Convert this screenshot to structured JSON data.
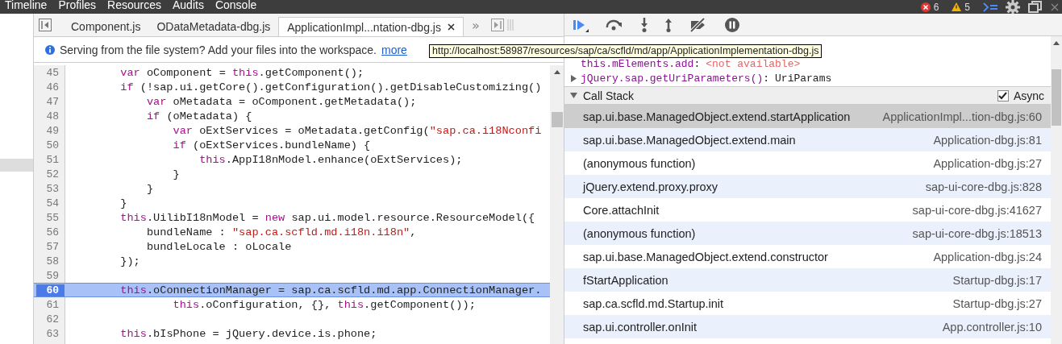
{
  "menu_bar": {
    "items": [
      "Timeline",
      "Profiles",
      "Resources",
      "Audits",
      "Console"
    ],
    "errors": "6",
    "warnings": "5"
  },
  "editor": {
    "tabs": [
      {
        "label": "Component.js",
        "selected": false,
        "closable": false
      },
      {
        "label": "ODataMetadata-dbg.js",
        "selected": false,
        "closable": false
      },
      {
        "label": "ApplicationImpl...ntation-dbg.js",
        "selected": true,
        "closable": true
      }
    ],
    "more_tabs": "»",
    "infobar": {
      "message": "Serving from the file system? Add your files into the workspace.",
      "link": "more"
    },
    "tooltip": "http://localhost:58987/resources/sap/ca/scfld/md/app/ApplicationImplementation-dbg.js",
    "lines": [
      {
        "number": "45",
        "selected": false,
        "segments": [
          {
            "kind": "keyword",
            "text": "        var"
          },
          {
            "kind": "plain",
            "text": " oComponent = "
          },
          {
            "kind": "keyword",
            "text": "this"
          },
          {
            "kind": "plain",
            "text": ".getComponent();"
          }
        ]
      },
      {
        "number": "46",
        "selected": false,
        "segments": [
          {
            "kind": "keyword",
            "text": "        if"
          },
          {
            "kind": "plain",
            "text": " (!sap.ui.getCore().getConfiguration().getDisableCustomizing()"
          }
        ]
      },
      {
        "number": "47",
        "selected": false,
        "segments": [
          {
            "kind": "keyword",
            "text": "            var"
          },
          {
            "kind": "plain",
            "text": " oMetadata = oComponent.getMetadata();"
          }
        ]
      },
      {
        "number": "48",
        "selected": false,
        "segments": [
          {
            "kind": "keyword",
            "text": "            if"
          },
          {
            "kind": "plain",
            "text": " (oMetadata) {"
          }
        ]
      },
      {
        "number": "49",
        "selected": false,
        "segments": [
          {
            "kind": "keyword",
            "text": "                var"
          },
          {
            "kind": "plain",
            "text": " oExtServices = oMetadata.getConfig("
          },
          {
            "kind": "string",
            "text": "\"sap.ca.i18Nconfi"
          }
        ]
      },
      {
        "number": "50",
        "selected": false,
        "segments": [
          {
            "kind": "keyword",
            "text": "                if"
          },
          {
            "kind": "plain",
            "text": " (oExtServices.bundleName) {"
          }
        ]
      },
      {
        "number": "51",
        "selected": false,
        "segments": [
          {
            "kind": "keyword",
            "text": "                    this"
          },
          {
            "kind": "plain",
            "text": ".AppI18nModel.enhance(oExtServices);"
          }
        ]
      },
      {
        "number": "52",
        "selected": false,
        "segments": [
          {
            "kind": "plain",
            "text": "                }"
          }
        ]
      },
      {
        "number": "53",
        "selected": false,
        "segments": [
          {
            "kind": "plain",
            "text": "            }"
          }
        ]
      },
      {
        "number": "54",
        "selected": false,
        "segments": [
          {
            "kind": "plain",
            "text": "        }"
          }
        ]
      },
      {
        "number": "55",
        "selected": false,
        "segments": [
          {
            "kind": "keyword",
            "text": "        this"
          },
          {
            "kind": "plain",
            "text": ".UilibI18nModel = "
          },
          {
            "kind": "keyword",
            "text": "new"
          },
          {
            "kind": "plain",
            "text": " sap.ui.model.resource.ResourceModel({"
          }
        ]
      },
      {
        "number": "56",
        "selected": false,
        "segments": [
          {
            "kind": "plain",
            "text": "            bundleName : "
          },
          {
            "kind": "string",
            "text": "\"sap.ca.scfld.md.i18n.i18n\""
          },
          {
            "kind": "plain",
            "text": ","
          }
        ]
      },
      {
        "number": "57",
        "selected": false,
        "segments": [
          {
            "kind": "plain",
            "text": "            bundleLocale : oLocale"
          }
        ]
      },
      {
        "number": "58",
        "selected": false,
        "segments": [
          {
            "kind": "plain",
            "text": "        });"
          }
        ]
      },
      {
        "number": "59",
        "selected": false
      },
      {
        "number": "60",
        "selected": true,
        "segments": [
          {
            "kind": "keyword",
            "text": "        this"
          },
          {
            "kind": "plain",
            "text": ".oConnectionManager = sap.ca.scfld.md.app.ConnectionManager."
          }
        ]
      },
      {
        "number": "61",
        "selected": false,
        "segments": [
          {
            "kind": "keyword",
            "text": "                this"
          },
          {
            "kind": "plain",
            "text": ".oConfiguration, {}, "
          },
          {
            "kind": "keyword",
            "text": "this"
          },
          {
            "kind": "plain",
            "text": ".getComponent());"
          }
        ]
      },
      {
        "number": "62",
        "selected": false
      },
      {
        "number": "63",
        "selected": false,
        "segments": [
          {
            "kind": "keyword",
            "text": "        this"
          },
          {
            "kind": "plain",
            "text": ".bIsPhone = jQuery.device.is.phone;"
          }
        ]
      }
    ]
  },
  "debugger": {
    "watch": [
      {
        "name": "this.mElements.add",
        "separator": ":",
        "value": "<not available>",
        "kind": "unavailable",
        "expandable": false
      },
      {
        "name": "jQuery.sap.getUriParameters()",
        "separator": ":",
        "value": "UriParams",
        "kind": "object",
        "expandable": true
      }
    ],
    "call_stack": {
      "title": "Call Stack",
      "expanded": true,
      "async_label": "Async",
      "async_checked": true,
      "frames": [
        {
          "function": "sap.ui.base.ManagedObject.extend.startApplication",
          "location": "ApplicationImpl...tion-dbg.js:60",
          "selected": true
        },
        {
          "function": "sap.ui.base.ManagedObject.extend.main",
          "location": "Application-dbg.js:81",
          "selected": false
        },
        {
          "function": "(anonymous function)",
          "location": "Application-dbg.js:27",
          "selected": false
        },
        {
          "function": "jQuery.extend.proxy.proxy",
          "location": "sap-ui-core-dbg.js:828",
          "selected": false
        },
        {
          "function": "Core.attachInit",
          "location": "sap-ui-core-dbg.js:41627",
          "selected": false
        },
        {
          "function": "(anonymous function)",
          "location": "sap-ui-core-dbg.js:18513",
          "selected": false
        },
        {
          "function": "sap.ui.base.ManagedObject.extend.constructor",
          "location": "Application-dbg.js:24",
          "selected": false
        },
        {
          "function": "fStartApplication",
          "location": "Startup-dbg.js:17",
          "selected": false
        },
        {
          "function": "sap.ca.scfld.md.Startup.init",
          "location": "Startup-dbg.js:27",
          "selected": false
        },
        {
          "function": "sap.ui.controller.onInit",
          "location": "App.controller.js:10",
          "selected": false
        }
      ]
    }
  }
}
